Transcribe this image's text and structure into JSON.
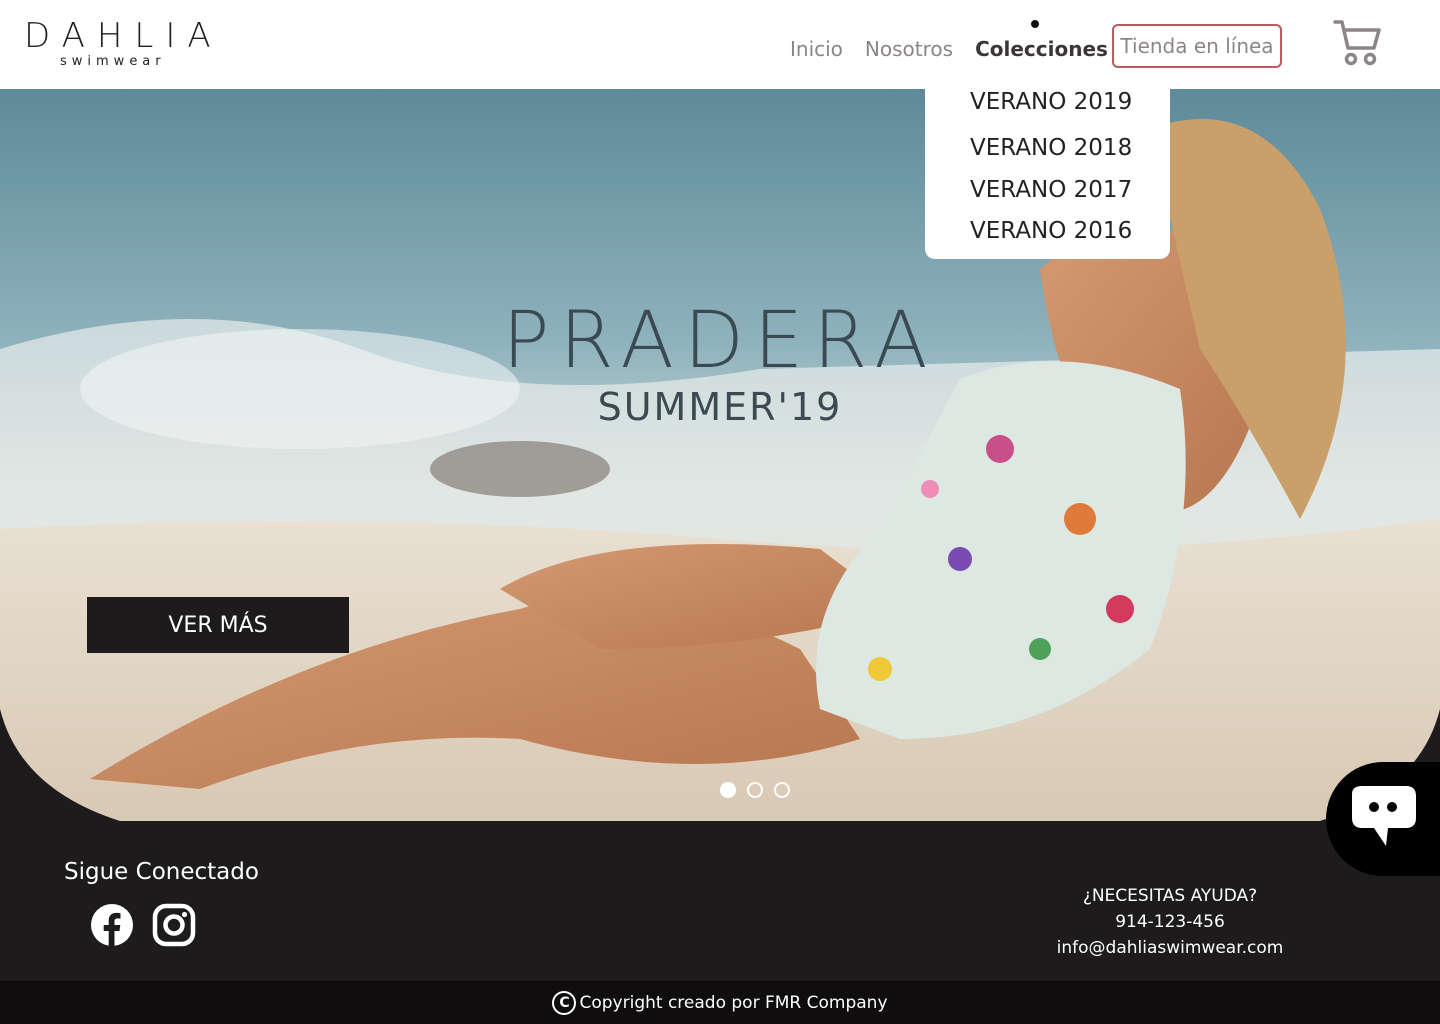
{
  "brand": {
    "name": "DAHLIA",
    "tagline": "swimwear"
  },
  "nav": {
    "items": [
      {
        "label": "Inicio",
        "active": false
      },
      {
        "label": "Nosotros",
        "active": false
      },
      {
        "label": "Colecciones",
        "active": true
      }
    ],
    "shop_label": "Tienda en línea",
    "cart_icon": "shopping-cart-icon"
  },
  "dropdown": {
    "items": [
      {
        "label": "VERANO 2019"
      },
      {
        "label": "VERANO 2018"
      },
      {
        "label": "VERANO 2017"
      },
      {
        "label": "VERANO 2016"
      }
    ]
  },
  "hero": {
    "title": "PRADERA",
    "subtitle": "SUMMER'19",
    "cta_label": "VER MÁS",
    "slides_total": 3,
    "active_slide": 1
  },
  "footer": {
    "follow_label": "Sigue Conectado",
    "social_icons": [
      "facebook-icon",
      "instagram-icon"
    ],
    "help_title": "¿NECESITAS AYUDA?",
    "phone": "914-123-456",
    "email": "info@dahliaswimwear.com",
    "copyright": "Copyright creado por FMR Company"
  },
  "colors": {
    "accent": "#c0585f",
    "dark": "#1e1b1c",
    "nav_text": "#8c8587"
  }
}
